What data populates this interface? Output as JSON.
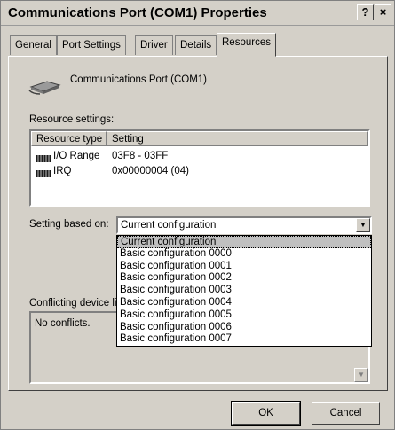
{
  "window": {
    "title": "Communications Port (COM1) Properties",
    "help_glyph": "?",
    "close_glyph": "×"
  },
  "tabs": [
    {
      "label": "General"
    },
    {
      "label": "Port Settings"
    },
    {
      "label": "Driver"
    },
    {
      "label": "Details"
    },
    {
      "label": "Resources",
      "active": true
    }
  ],
  "device": {
    "name": "Communications Port (COM1)",
    "icon": "serial-port-icon"
  },
  "resources": {
    "label": "Resource settings:",
    "columns": [
      "Resource type",
      "Setting"
    ],
    "rows": [
      {
        "type": "I/O Range",
        "setting": "03F8 - 03FF",
        "icon": "chip-icon"
      },
      {
        "type": "IRQ",
        "setting": "0x00000004 (04)",
        "icon": "chip-icon"
      }
    ]
  },
  "setting_based_on": {
    "label": "Setting based on:",
    "value": "Current configuration",
    "options": [
      "Current configuration",
      "Basic configuration 0000",
      "Basic configuration 0001",
      "Basic configuration 0002",
      "Basic configuration 0003",
      "Basic configuration 0004",
      "Basic configuration 0005",
      "Basic configuration 0006",
      "Basic configuration 0007"
    ]
  },
  "conflicts": {
    "label": "Conflicting device li",
    "text": "No conflicts."
  },
  "buttons": {
    "ok": "OK",
    "cancel": "Cancel"
  }
}
